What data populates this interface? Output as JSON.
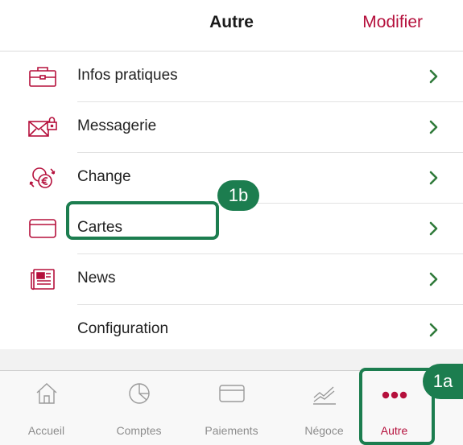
{
  "header": {
    "title": "Autre",
    "action_label": "Modifier"
  },
  "menu": {
    "items": [
      {
        "label": "Infos pratiques",
        "icon": "briefcase-icon"
      },
      {
        "label": "Messagerie",
        "icon": "mail-lock-icon"
      },
      {
        "label": "Change",
        "icon": "currency-exchange-icon"
      },
      {
        "label": "Cartes",
        "icon": "credit-card-icon"
      },
      {
        "label": "News",
        "icon": "newspaper-icon"
      },
      {
        "label": "Configuration",
        "icon": ""
      }
    ]
  },
  "tabbar": {
    "tabs": [
      {
        "label": "Accueil",
        "icon": "home-icon"
      },
      {
        "label": "Comptes",
        "icon": "pie-chart-icon"
      },
      {
        "label": "Paiements",
        "icon": "card-icon"
      },
      {
        "label": "Négoce",
        "icon": "trend-chart-icon"
      },
      {
        "label": "Autre",
        "icon": "more-dots-icon"
      }
    ],
    "active_index": 4
  },
  "annotations": {
    "cards_badge": "1b",
    "autre_badge": "1a"
  },
  "colors": {
    "accent": "#b5103c",
    "chevron": "#2f7a3a",
    "annotation": "#1c7d4f",
    "tab_inactive": "#8c8c8c"
  }
}
